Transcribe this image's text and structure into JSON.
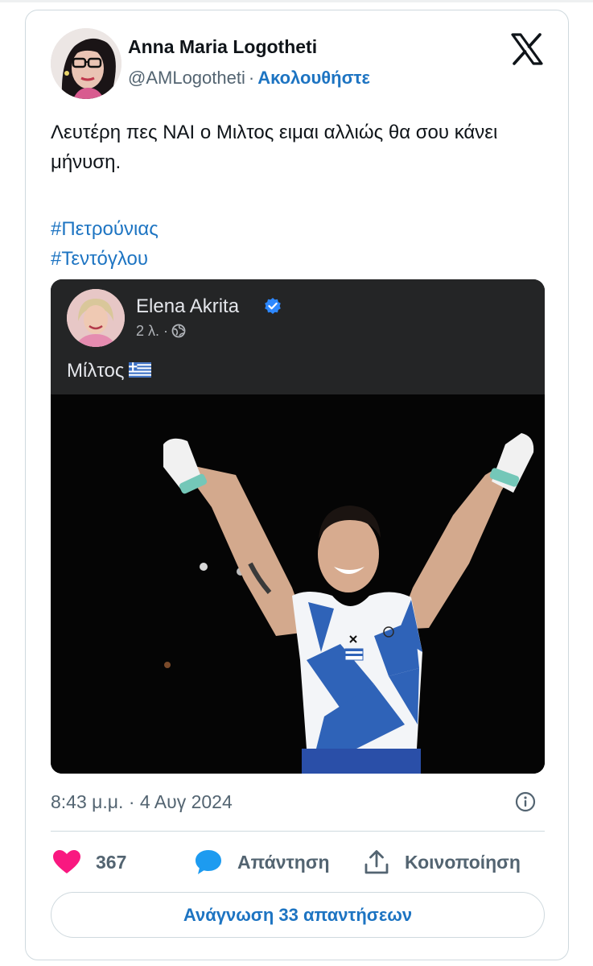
{
  "tweet": {
    "author_name": "Anna Maria Logotheti",
    "handle": "@AMLogotheti",
    "separator": "·",
    "follow_label": "Ακολουθήστε",
    "text": "Λευτέρη πες ΝΑΙ ο Μιλτος ειμαι αλλιώς θα σου κάνει μήνυση.",
    "hashtags": [
      "#Πετρούνιας",
      "#Τεντόγλου"
    ],
    "timestamp": "8:43 μ.μ. · 4 Αυγ 2024"
  },
  "embedded_post": {
    "author_name": "Elena Akrita",
    "meta": "2 λ. ·",
    "caption": "Μίλτος"
  },
  "actions": {
    "like_count": "367",
    "reply_label": "Απάντηση",
    "share_label": "Κοινοποίηση"
  },
  "read_replies_label": "Ανάγνωση 33 απαντήσεων",
  "colors": {
    "accent": "#1d74c2",
    "like": "#f91880",
    "reply_bubble": "#1d9bf0",
    "muted_text": "#536471",
    "border": "#cfd9de"
  },
  "icons": {
    "brand": "x-logo-icon",
    "verified": "verified-badge-icon",
    "privacy": "globe-icon",
    "flag": "greek-flag-icon",
    "info": "info-icon",
    "like": "heart-icon",
    "reply": "speech-bubble-icon",
    "share": "share-icon"
  }
}
